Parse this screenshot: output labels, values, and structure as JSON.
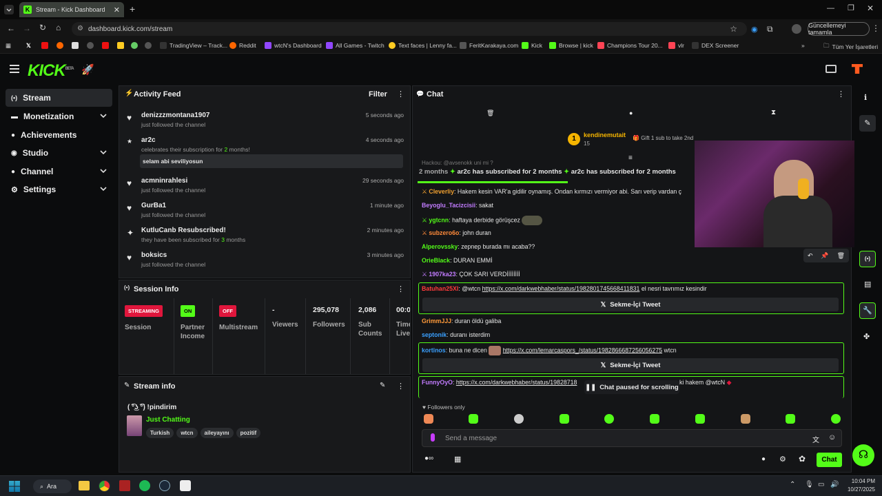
{
  "browser": {
    "tab_title": "Stream - Kick Dashboard",
    "url": "dashboard.kick.com/stream",
    "update_label": "Güncellemeyi tamamla",
    "bookmarks": [
      "TradingView – Track...",
      "Reddit",
      "wtcN's Dashboard",
      "All Games - Twitch",
      "Text faces | Lenny fa...",
      "FeritKarakaya.com",
      "Kick",
      "Browse | kick",
      "Champions Tour 20...",
      "vlr",
      "DEX Screener"
    ],
    "all_bookmarks": "Tüm Yer İşaretleri"
  },
  "kick": {
    "logo": "KICK",
    "beta": "BETA"
  },
  "sidebar": {
    "items": [
      {
        "label": "Stream",
        "icon": "broadcast-icon"
      },
      {
        "label": "Monetization",
        "icon": "dollar-icon"
      },
      {
        "label": "Achievements",
        "icon": "user-icon"
      },
      {
        "label": "Studio",
        "icon": "camera-icon"
      },
      {
        "label": "Channel",
        "icon": "user-icon"
      },
      {
        "label": "Settings",
        "icon": "gear-icon"
      }
    ]
  },
  "activity": {
    "title": "Activity Feed",
    "filter": "Filter",
    "items": [
      {
        "name": "denizzzmontana1907",
        "sub": "just followed the channel",
        "time": "5 seconds ago"
      },
      {
        "name": "ar2c",
        "sub_pre": "celebrates their subscription for ",
        "sub_num": "2",
        "sub_post": " months!",
        "msg": "selam abi seviliyosun",
        "time": "4 seconds ago"
      },
      {
        "name": "acmninrahlesi",
        "sub": "just followed the channel",
        "time": "29 seconds ago"
      },
      {
        "name": "GurBa1",
        "sub": "just followed the channel",
        "time": "1 minute ago"
      },
      {
        "name": "KutluCanb Resubscribed!",
        "sub_pre": "they have been subscribed for ",
        "sub_num": "3",
        "sub_post": " months",
        "time": "2 minutes ago"
      },
      {
        "name": "boksics",
        "sub": "just followed the channel",
        "time": "3 minutes ago"
      }
    ]
  },
  "session": {
    "title": "Session Info",
    "badges": [
      {
        "label": "STREAMING",
        "name": "Session"
      },
      {
        "label": "ON",
        "name": "Partner Income"
      },
      {
        "label": "OFF",
        "name": "Multistream"
      }
    ],
    "stats": [
      {
        "value": "-",
        "label": "Viewers"
      },
      {
        "value": "295,078",
        "label": "Followers"
      },
      {
        "value": "2,086",
        "label": "Sub Counts"
      },
      {
        "value": "00:0",
        "label": "Time Live"
      }
    ]
  },
  "stream_info": {
    "title": "Stream info",
    "stream_title": "( ͡°͜ʖ ͡°) !pindirim",
    "category": "Just Chatting",
    "tags": [
      "Turkish",
      "wtcn",
      "aileyayını",
      "pozitif"
    ]
  },
  "chat": {
    "title": "Chat",
    "top_gifter": "kendinemutait",
    "top_gifter_count": "15",
    "gift_hint": "Gift 1 sub to take 2nd",
    "ticker": [
      "2 months",
      "ar2c has subscribed for 2 months",
      "ar2c has subscribed for 2 months"
    ],
    "ticker_cut": "Hackou: @avsenokk uni mi ?",
    "messages": [
      {
        "user": "Cleverliy",
        "color": "#f0a030",
        "text": "Hakem kesin VAR'a gidilir oynamış. Ondan kırmızı vermiyor abi. Sarı verip vardan ç"
      },
      {
        "user": "Beyoglu_Tacizcisii",
        "color": "#c27cff",
        "text": "sakat"
      },
      {
        "user": "ygtcnn",
        "color": "#53fc18",
        "text": "haftaya derbide görüşcez"
      },
      {
        "user": "subzero6o",
        "color": "#ff8a3a",
        "text": "john duran"
      },
      {
        "user": "Alperovssky",
        "color": "#53fc18",
        "text": "zepnep burada mı acaba??"
      },
      {
        "user": "OrieBlack",
        "color": "#53fc18",
        "text": "DURAN EMMİ"
      },
      {
        "user": "1907ka23",
        "color": "#c27cff",
        "text": "ÇOK SARI VERDİİİİİİİİ"
      },
      {
        "user": "Batuhan25XI",
        "color": "#ff3a3a",
        "pre": "@wtcn ",
        "link": "https://x.com/darkwebhaber/status/1982801745668411831",
        "text": " el nesri tavrımız kesindir"
      },
      {
        "user": "GrimmJJJ",
        "color": "#ff9a3a",
        "text": "duran öldü galiba"
      },
      {
        "user": "septonik",
        "color": "#3aa0ff",
        "text": "duranı isterdim"
      },
      {
        "user": "kortinos",
        "color": "#3aa0ff",
        "pre": "buna ne dicen ",
        "link": "https://x.com/lemarcaspors_/status/1982866687256056275",
        "text": " wtcn"
      },
      {
        "user": "FunnyOyO",
        "color": "#c27cff",
        "link": "https://x.com/darkwebhaber/status/19828718",
        "text": "ki hakem @wtcN"
      }
    ],
    "tweet_btn": "Sekme-İçi Tweet",
    "paused": "Chat paused for scrolling",
    "followers_only": "Followers only",
    "placeholder": "Send a message",
    "send": "Chat"
  },
  "taskbar": {
    "search": "Ara",
    "time": "10:04 PM",
    "date": "10/27/2025"
  },
  "colors": {
    "accent": "#53fc18",
    "streaming": "#e0163c",
    "panel": "#18191b"
  }
}
